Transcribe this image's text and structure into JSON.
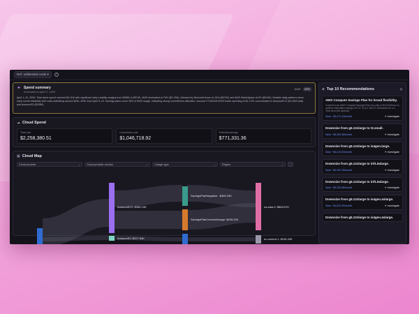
{
  "topbar": {
    "filter_label": "Ref: unblended costs ▾",
    "help_icon": "?"
  },
  "summary": {
    "title": "Spend summary",
    "subtitle": "Generated on April 17, 2026",
    "toggle": [
      "WoW",
      "MTD"
    ],
    "body": "April 1–12, 2026: Total cloud spend reached $4.11M with significant daily volatility ranging from $388K to $574K. AWS dominated at 76% ($3.13M), followed by Microsoft Azure at 16% ($674K) and AWS Marketplace at 6% ($244K). Notable daily patterns show early month instability with costs stabilizing around $430–440K from April 8–10. Savings plans cover 28% of AWS usage, indicating strong commitment utilization. Account 0718432874203 leads spending at $1.17M, concentrated in AmazonEC2 ($1.05M total) and AmazonS3 ($338K)."
  },
  "cloud_spend": {
    "title": "Cloud Spend",
    "cards": [
      {
        "label": "Total cost",
        "value": "$2,258,380.51"
      },
      {
        "label": "Kubernetes cost",
        "value": "$1,046,718.92"
      },
      {
        "label": "Potential savings",
        "value": "$771,331.36"
      }
    ]
  },
  "cloud_map": {
    "title": "Cloud Map",
    "selectors": [
      "Cloud provider",
      "Cloud provider service",
      "Charge type",
      "Region"
    ],
    "nodes": {
      "ec2": "AmazonEC2: $365.13K",
      "s3": "AmazonS3: $227.84K",
      "negation": "SavingsPlanNegation: -$365.23K",
      "covered": "SavingsPlanCoveredUsage: $405.24K",
      "useast2": "us-east-2: $863.67K",
      "eucentral": "eu-central-1: $106.43K"
    }
  },
  "recommendations": {
    "title": "Top 10 Recommendations",
    "investigate_label": "Investigate",
    "items": [
      {
        "name": "AWS Compute Savings Plan for broad flexibility.",
        "desc": "Commit to an AWS Compute Savings Plan at a rate of $140.00/hour to achieve estimated savings of 0.37 % (i.e. $3,471.23/month) for a 1-Year term (No Upfront).",
        "save": "Save ~$3,471.23/month"
      },
      {
        "name": "Downsize from g5.12xlarge to t2.small.",
        "desc": "",
        "save": "Save ~$3,390.98/month"
      },
      {
        "name": "Downsize from g5.12xlarge to is4gen.large.",
        "desc": "",
        "save": "Save ~$3,015.00/month"
      },
      {
        "name": "Downsize from g5.12xlarge to inf1.6xlarge.",
        "desc": "",
        "save": "Save ~$2,290.78/month"
      },
      {
        "name": "Downsize from g5.12xlarge to inf1.6xlarge.",
        "desc": "",
        "save": "Save ~$2,252.58/month"
      },
      {
        "name": "Downsize from g5.12xlarge to is4gen.4xlarge.",
        "desc": "",
        "save": "Save ~$1,813.00/month"
      },
      {
        "name": "Downsize from g5.12xlarge to is4gen.4xlarge.",
        "desc": "",
        "save": ""
      }
    ]
  },
  "colors": {
    "accent": "#6f93ff",
    "purple": "#9b6ff0",
    "teal": "#3a9a8c",
    "orange": "#d57a2b",
    "pink": "#e06fa8",
    "blue": "#2f6bd1"
  }
}
